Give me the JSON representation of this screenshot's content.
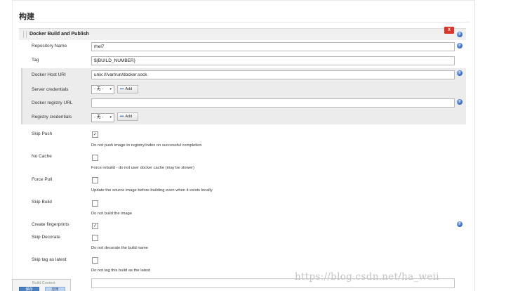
{
  "section_title": "构建",
  "builder": {
    "title": "Docker Build and Publish",
    "close_label": "X"
  },
  "fields": {
    "repository_name": {
      "label": "Repository Name",
      "value": "rhel7"
    },
    "tag": {
      "label": "Tag",
      "value": "${BUILD_NUMBER}"
    },
    "docker_host_uri": {
      "label": "Docker Host URI",
      "value": "unix:///var/run/docker.sock"
    },
    "server_credentials": {
      "label": "Server credentials",
      "selected": "- 无 -",
      "add_label": "Add"
    },
    "docker_registry_url": {
      "label": "Docker registry URL",
      "value": ""
    },
    "registry_credentials": {
      "label": "Registry credentials",
      "selected": "- 无 -",
      "add_label": "Add"
    }
  },
  "options": [
    {
      "label": "Skip Push",
      "checked": true,
      "description": "Do not push image to registry/index on successful completion"
    },
    {
      "label": "No Cache",
      "checked": false,
      "description": "Force rebuild - do not user docker cache (may be slower)"
    },
    {
      "label": "Force Pull",
      "checked": false,
      "description": "Update the source image before building even when it exists locally"
    },
    {
      "label": "Skip Build",
      "checked": false,
      "description": "Do not build the image"
    },
    {
      "label": "Create fingerprints",
      "checked": true,
      "description": ""
    },
    {
      "label": "Skip Decorate",
      "checked": false,
      "description": "Do not decorate the build name"
    },
    {
      "label": "Skip tag as latest",
      "checked": false,
      "description": "Do not tag this build as the latest"
    }
  ],
  "help_glyph": "?",
  "check_glyph": "✓",
  "caret_glyph": "▾",
  "key_glyph": "⊷",
  "bottom_bar": {
    "label": "Build Context",
    "save_label": "保存",
    "apply_label": "应用"
  },
  "watermark": "https://blog.csdn.net/ha_weii",
  "colors": {
    "close_button": "#d9352b",
    "help_icon": "#3a6fc4",
    "shaded_row": "#ececec",
    "primary_button": "#4a7fc1"
  }
}
